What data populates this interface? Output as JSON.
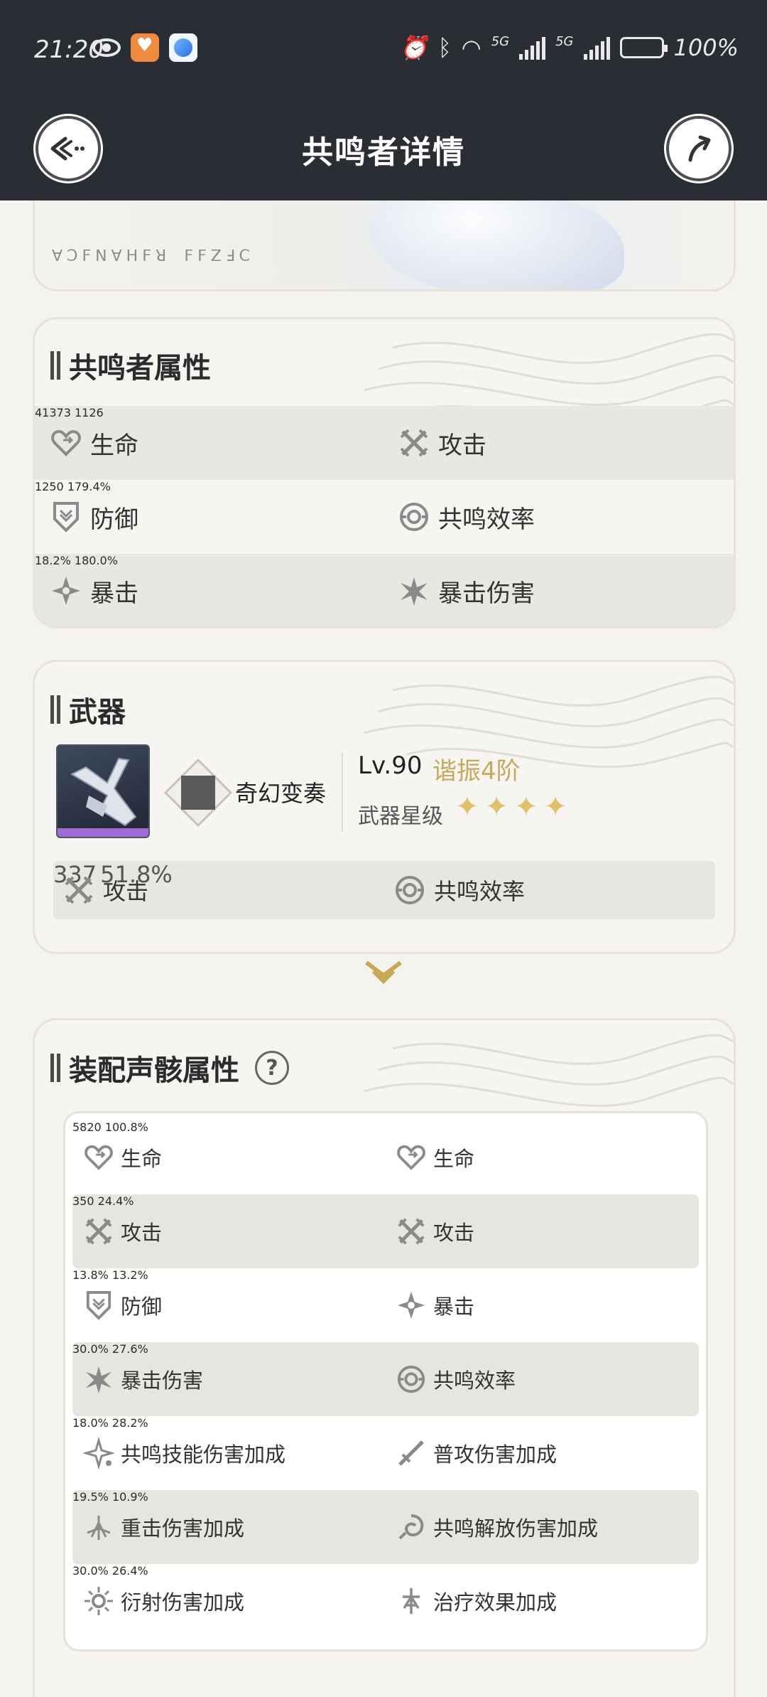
{
  "status_bar": {
    "time": "21:20",
    "network1": "5G",
    "network2": "5G",
    "battery": "100%"
  },
  "header": {
    "title": "共鸣者详情"
  },
  "hero": {
    "runes": "ꓯꓛꓝꓠꓯꓧꓝꓤ ꓝꓝꓜꓞꓚ"
  },
  "resonator_stats": {
    "title": "共鸣者属性",
    "rows": [
      [
        {
          "icon": "heart-icon",
          "label": "生命",
          "value": "41373"
        },
        {
          "icon": "sword-cross-icon",
          "label": "攻击",
          "value": "1126"
        }
      ],
      [
        {
          "icon": "shield-icon",
          "label": "防御",
          "value": "1250"
        },
        {
          "icon": "energy-ring-icon",
          "label": "共鸣效率",
          "value": "179.4%"
        }
      ],
      [
        {
          "icon": "sparkle-icon",
          "label": "暴击",
          "value": "18.2%"
        },
        {
          "icon": "burst-icon",
          "label": "暴击伤害",
          "value": "180.0%"
        }
      ]
    ]
  },
  "weapon": {
    "title": "武器",
    "name": "奇幻变奏",
    "level": "Lv.90",
    "rank": "谐振4阶",
    "star_label": "武器星级",
    "stars": 4,
    "stats": [
      {
        "icon": "sword-cross-icon",
        "label": "攻击",
        "value": "337"
      },
      {
        "icon": "energy-ring-icon",
        "label": "共鸣效率",
        "value": "51.8%"
      }
    ]
  },
  "echo_stats": {
    "title": "装配声骸属性",
    "help": "?",
    "rows": [
      [
        {
          "icon": "heart-icon",
          "label": "生命",
          "value": "5820"
        },
        {
          "icon": "heart-icon",
          "label": "生命",
          "value": "100.8%"
        }
      ],
      [
        {
          "icon": "sword-cross-icon",
          "label": "攻击",
          "value": "350"
        },
        {
          "icon": "sword-cross-icon",
          "label": "攻击",
          "value": "24.4%"
        }
      ],
      [
        {
          "icon": "shield-icon",
          "label": "防御",
          "value": "13.8%"
        },
        {
          "icon": "sparkle-icon",
          "label": "暴击",
          "value": "13.2%"
        }
      ],
      [
        {
          "icon": "burst-icon",
          "label": "暴击伤害",
          "value": "30.0%"
        },
        {
          "icon": "energy-ring-icon",
          "label": "共鸣效率",
          "value": "27.6%"
        }
      ],
      [
        {
          "icon": "skill-star-icon",
          "label": "共鸣技能伤害加成",
          "value": "18.0%"
        },
        {
          "icon": "slash-icon",
          "label": "普攻伤害加成",
          "value": "28.2%"
        }
      ],
      [
        {
          "icon": "heavy-attack-icon",
          "label": "重击伤害加成",
          "value": "19.5%"
        },
        {
          "icon": "swirl-icon",
          "label": "共鸣解放伤害加成",
          "value": "10.9%"
        }
      ],
      [
        {
          "icon": "diffraction-icon",
          "label": "衍射伤害加成",
          "value": "30.0%"
        },
        {
          "icon": "healing-icon",
          "label": "治疗效果加成",
          "value": "26.4%"
        }
      ]
    ]
  }
}
